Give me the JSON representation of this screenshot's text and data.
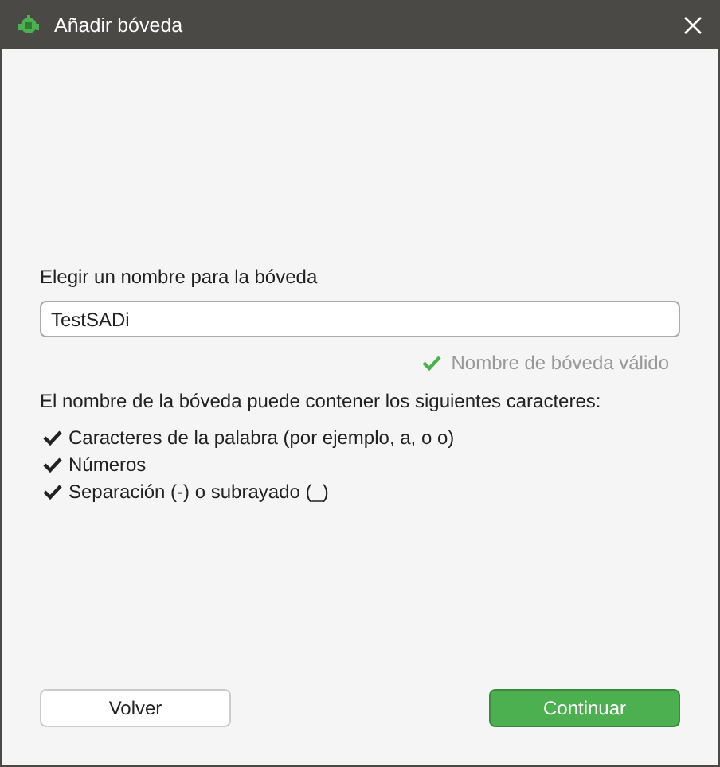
{
  "window": {
    "title": "Añadir bóveda"
  },
  "name_field": {
    "label": "Elegir un nombre para la bóveda",
    "value": "TestSADi"
  },
  "validation": {
    "text": "Nombre de bóveda válido",
    "valid": true
  },
  "rules": {
    "heading": "El nombre de la bóveda puede contener los siguientes caracteres:",
    "items": [
      "Caracteres de la palabra (por ejemplo, a, o o)",
      "Números",
      "Separación (-) o subrayado (_)"
    ]
  },
  "buttons": [
    {
      "label": "Volver",
      "kind": "secondary"
    },
    {
      "label": "Continuar",
      "kind": "primary"
    }
  ]
}
